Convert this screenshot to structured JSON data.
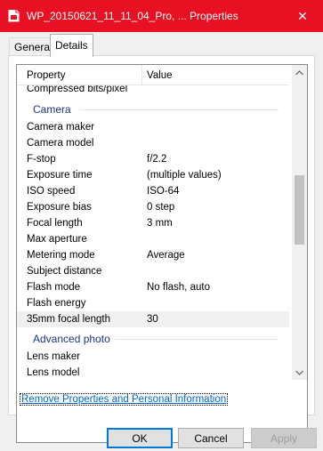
{
  "window": {
    "title": "WP_20150621_11_11_04_Pro, ... Properties",
    "close_glyph": "✕"
  },
  "tabs": [
    {
      "label": "General"
    },
    {
      "label": "Details"
    }
  ],
  "list": {
    "header_property": "Property",
    "header_value": "Value",
    "cut_row": "Compressed bits/pixel",
    "group_camera": "Camera",
    "rows": [
      {
        "p": "Camera maker",
        "v": ""
      },
      {
        "p": "Camera model",
        "v": ""
      },
      {
        "p": "F-stop",
        "v": "f/2.2"
      },
      {
        "p": "Exposure time",
        "v": "(multiple values)"
      },
      {
        "p": "ISO speed",
        "v": "ISO-64"
      },
      {
        "p": "Exposure bias",
        "v": "0 step"
      },
      {
        "p": "Focal length",
        "v": "3 mm"
      },
      {
        "p": "Max aperture",
        "v": ""
      },
      {
        "p": "Metering mode",
        "v": "Average"
      },
      {
        "p": "Subject distance",
        "v": ""
      },
      {
        "p": "Flash mode",
        "v": "No flash, auto"
      },
      {
        "p": "Flash energy",
        "v": ""
      },
      {
        "p": "35mm focal length",
        "v": "30"
      }
    ],
    "group_advanced": "Advanced photo",
    "rows2": [
      {
        "p": "Lens maker",
        "v": ""
      },
      {
        "p": "Lens model",
        "v": ""
      }
    ]
  },
  "remove_link": "Remove Properties and Personal Information",
  "buttons": {
    "ok": "OK",
    "cancel": "Cancel",
    "apply": "Apply"
  },
  "colors": {
    "titlebar": "#e81123",
    "group_text": "#1e3287",
    "link": "#0066cc"
  }
}
